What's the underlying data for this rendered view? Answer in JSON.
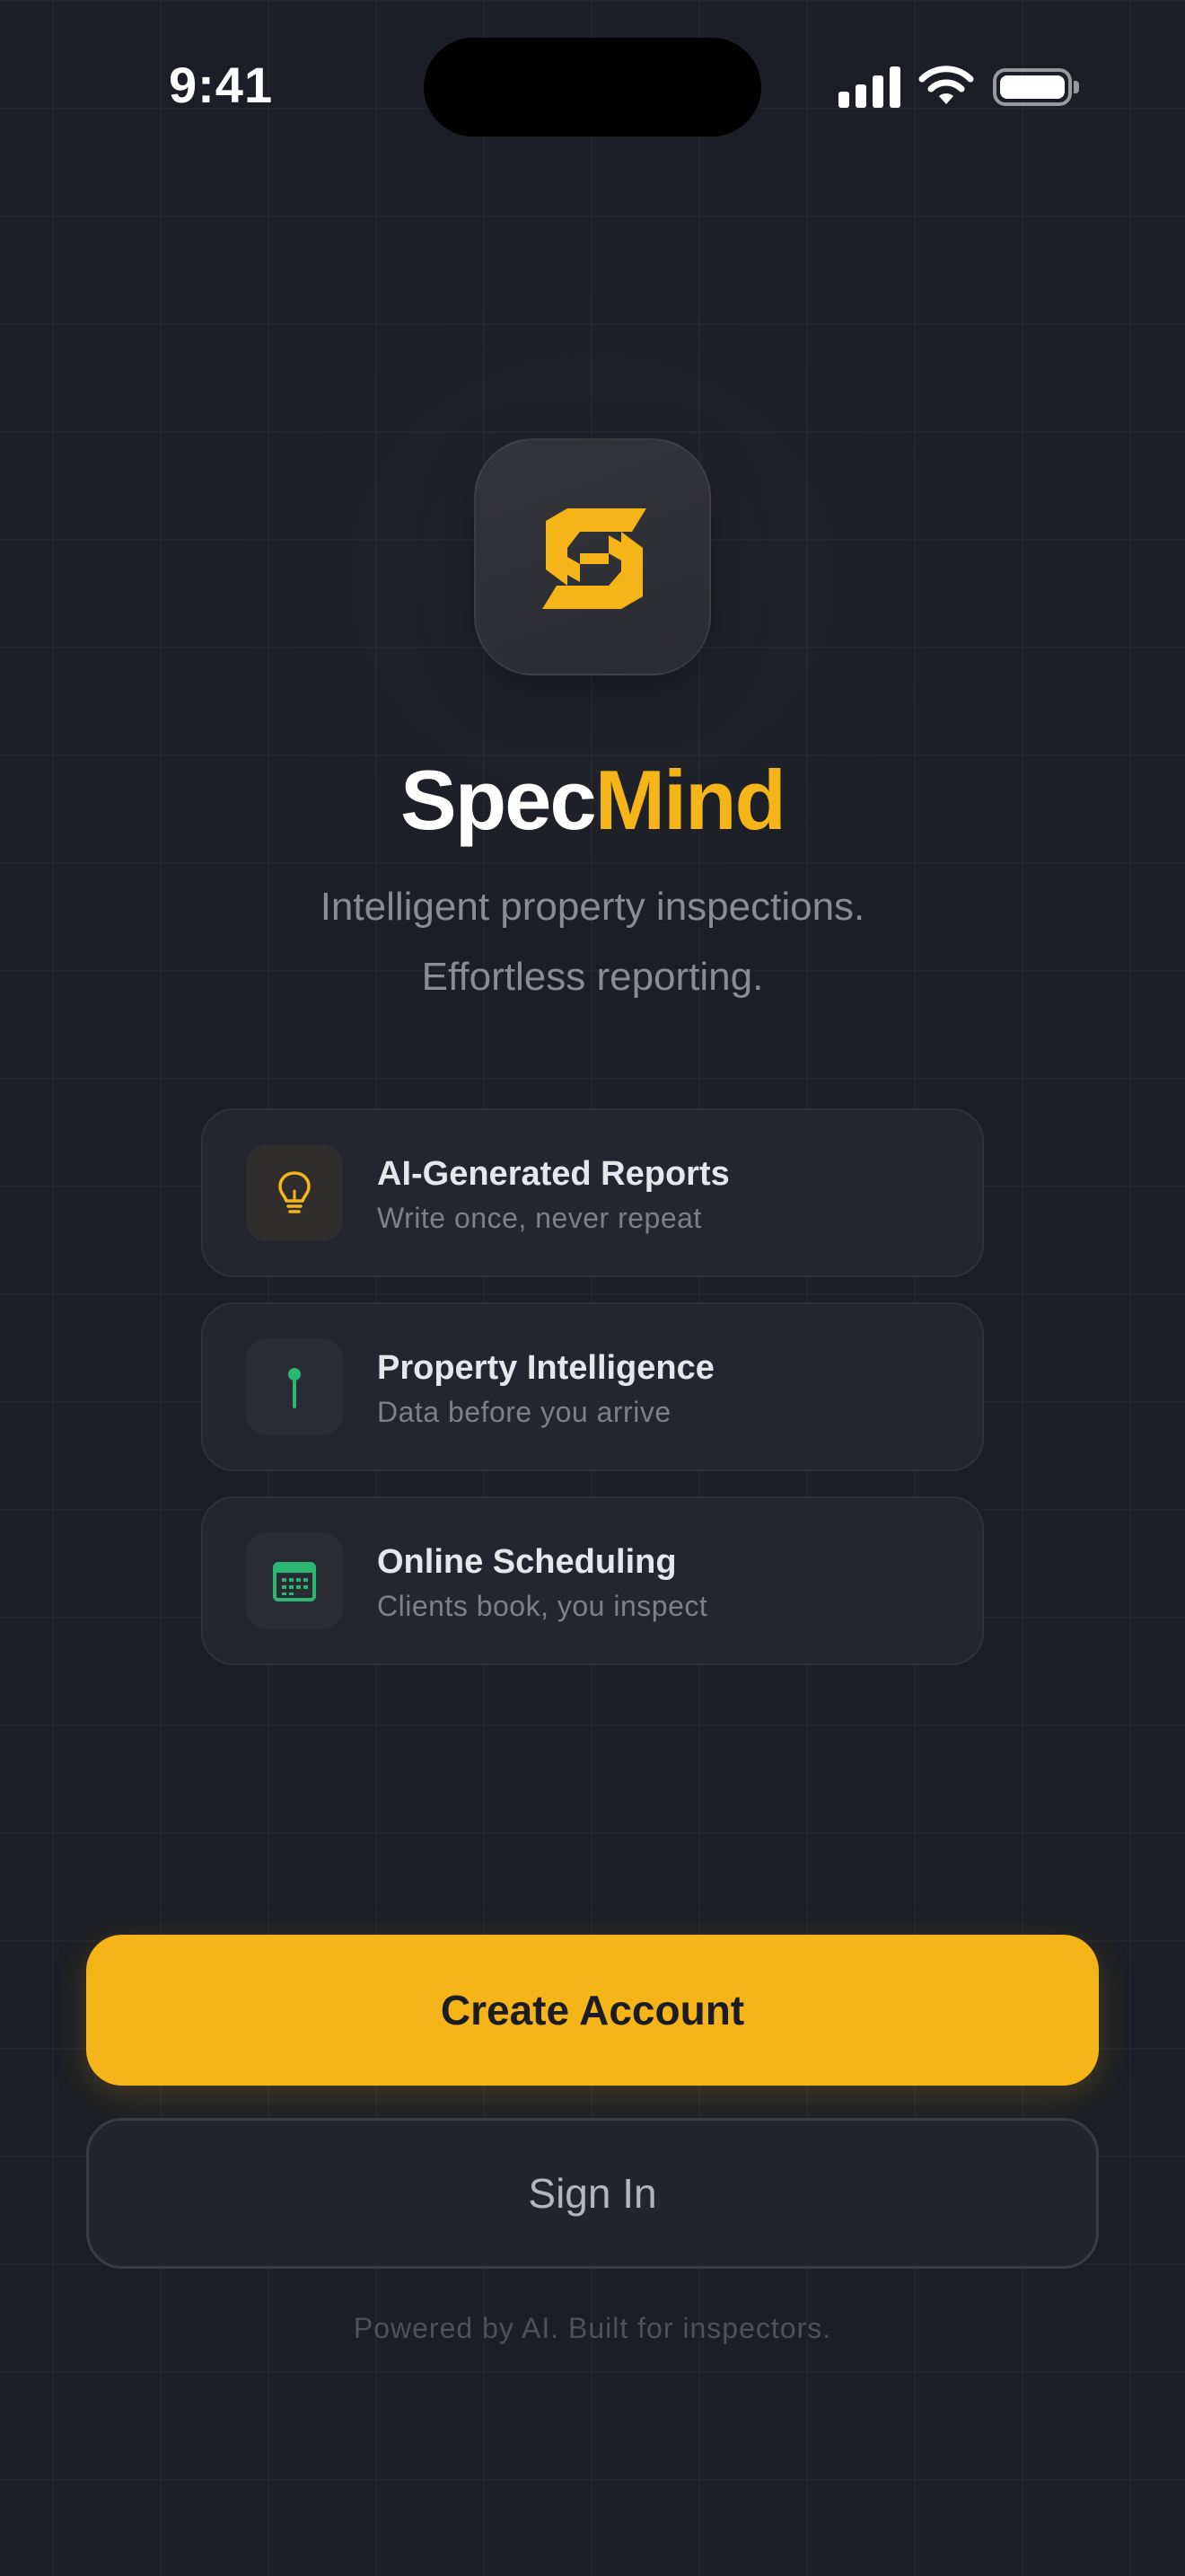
{
  "status_bar": {
    "time": "9:41",
    "icons": [
      "cellular-signal-icon",
      "wifi-icon",
      "battery-icon"
    ]
  },
  "logo": {
    "icon": "specmind-logo-icon"
  },
  "brand": {
    "part1": "Spec",
    "part2": "Mind"
  },
  "tagline": {
    "line1": "Intelligent property inspections.",
    "line2": "Effortless reporting."
  },
  "features": [
    {
      "icon": "lightbulb-icon",
      "title": "AI-Generated Reports",
      "subtitle": "Write once, never repeat"
    },
    {
      "icon": "map-pin-icon",
      "title": "Property Intelligence",
      "subtitle": "Data before you arrive"
    },
    {
      "icon": "calendar-icon",
      "title": "Online Scheduling",
      "subtitle": "Clients book, you inspect"
    }
  ],
  "actions": {
    "create_account": "Create Account",
    "sign_in": "Sign In"
  },
  "footer": "Powered by AI. Built for inspectors.",
  "colors": {
    "background": "#1b1e25",
    "accent": "#f5b418",
    "green": "#2bb673",
    "text_muted": "#8a8c92"
  }
}
